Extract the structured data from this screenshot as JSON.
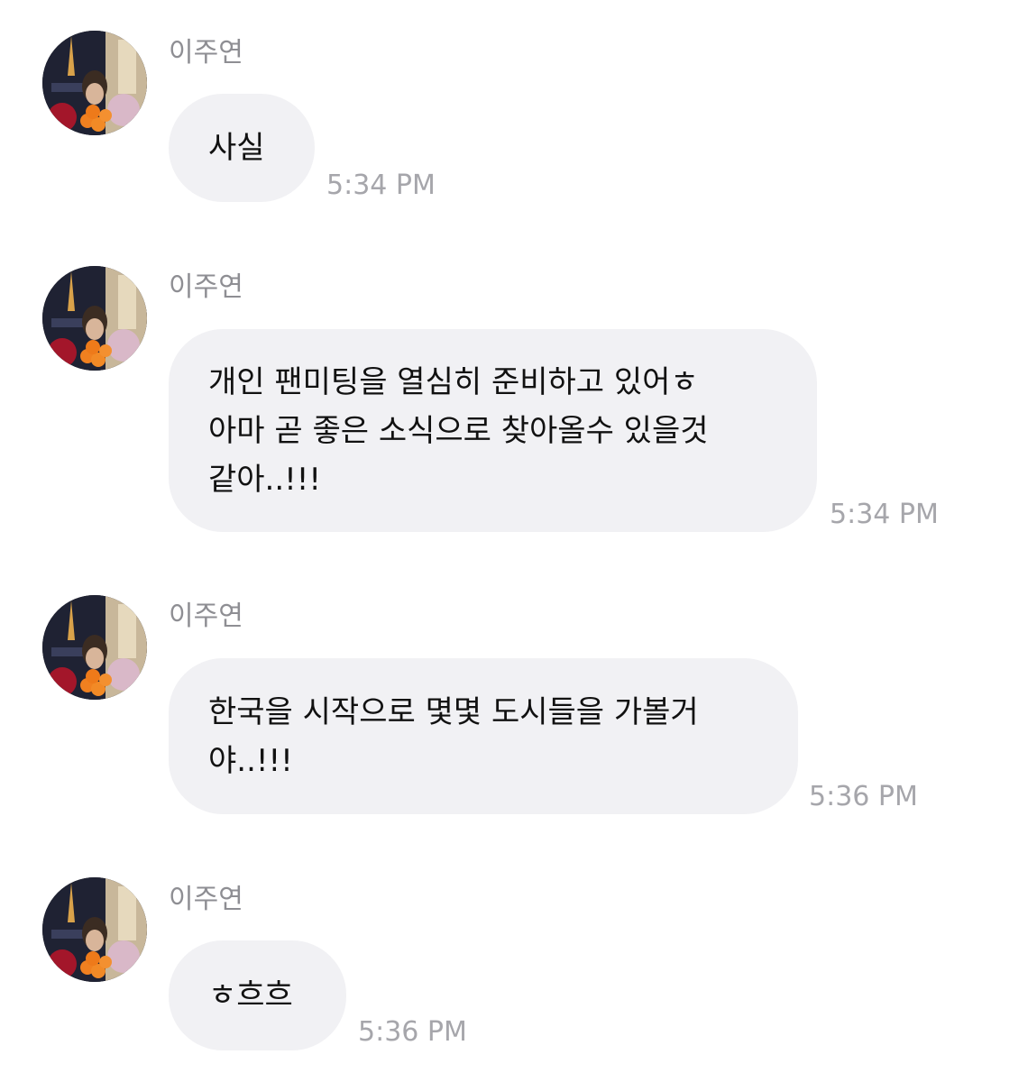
{
  "messages": [
    {
      "sender": "이주연",
      "text": "사실",
      "time": "5:34 PM"
    },
    {
      "sender": "이주연",
      "text": "개인 팬미팅을 열심히 준비하고 있어ㅎ\n아마 곧 좋은 소식으로 찾아올수 있을것\n같아..!!!",
      "time": "5:34 PM"
    },
    {
      "sender": "이주연",
      "text": "한국을 시작으로 몇몇 도시들을 가볼거\n야..!!!",
      "time": "5:36 PM"
    },
    {
      "sender": "이주연",
      "text": "ㅎ흐흐",
      "time": "5:36 PM"
    }
  ],
  "colors": {
    "bubble": "#f1f1f4",
    "sender": "#8e8e93",
    "time": "#a6a6ab",
    "text": "#111111"
  },
  "icons": {
    "avatar": "profile-photo-icon"
  }
}
